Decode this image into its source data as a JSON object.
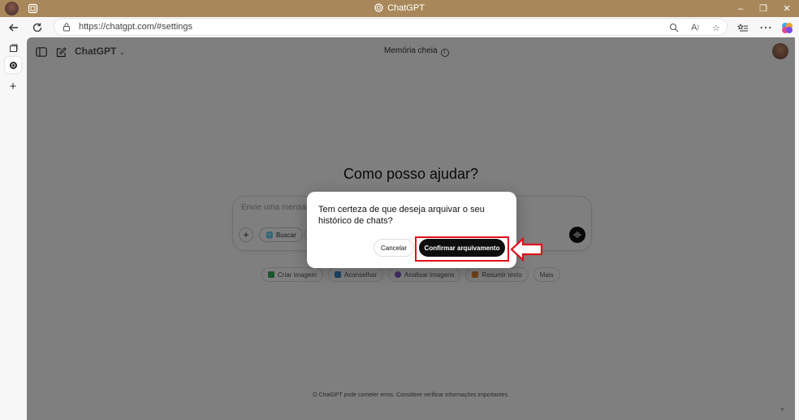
{
  "browser": {
    "tab_title": "ChatGPT",
    "url": "https://chatgpt.com/#settings"
  },
  "page": {
    "model_name": "ChatGPT",
    "memory_status": "Memória cheia",
    "headline": "Como posso ajudar?",
    "composer_placeholder": "Envie uma mensagem",
    "search_label": "Buscar",
    "chips": [
      "Criar imagem",
      "Aconselhar",
      "Analisar imagens",
      "Resumir texto",
      "Mais"
    ],
    "footer": "O ChatGPT pode cometer erros. Considere verificar informações importantes.",
    "help": "?"
  },
  "modal": {
    "message": "Tem certeza de que deseja arquivar o seu histórico de chats?",
    "cancel_label": "Cancelar",
    "confirm_label": "Confirmar arquivamento"
  },
  "colors": {
    "titlebar": "#a8885a",
    "annotation": "#e0101a"
  }
}
